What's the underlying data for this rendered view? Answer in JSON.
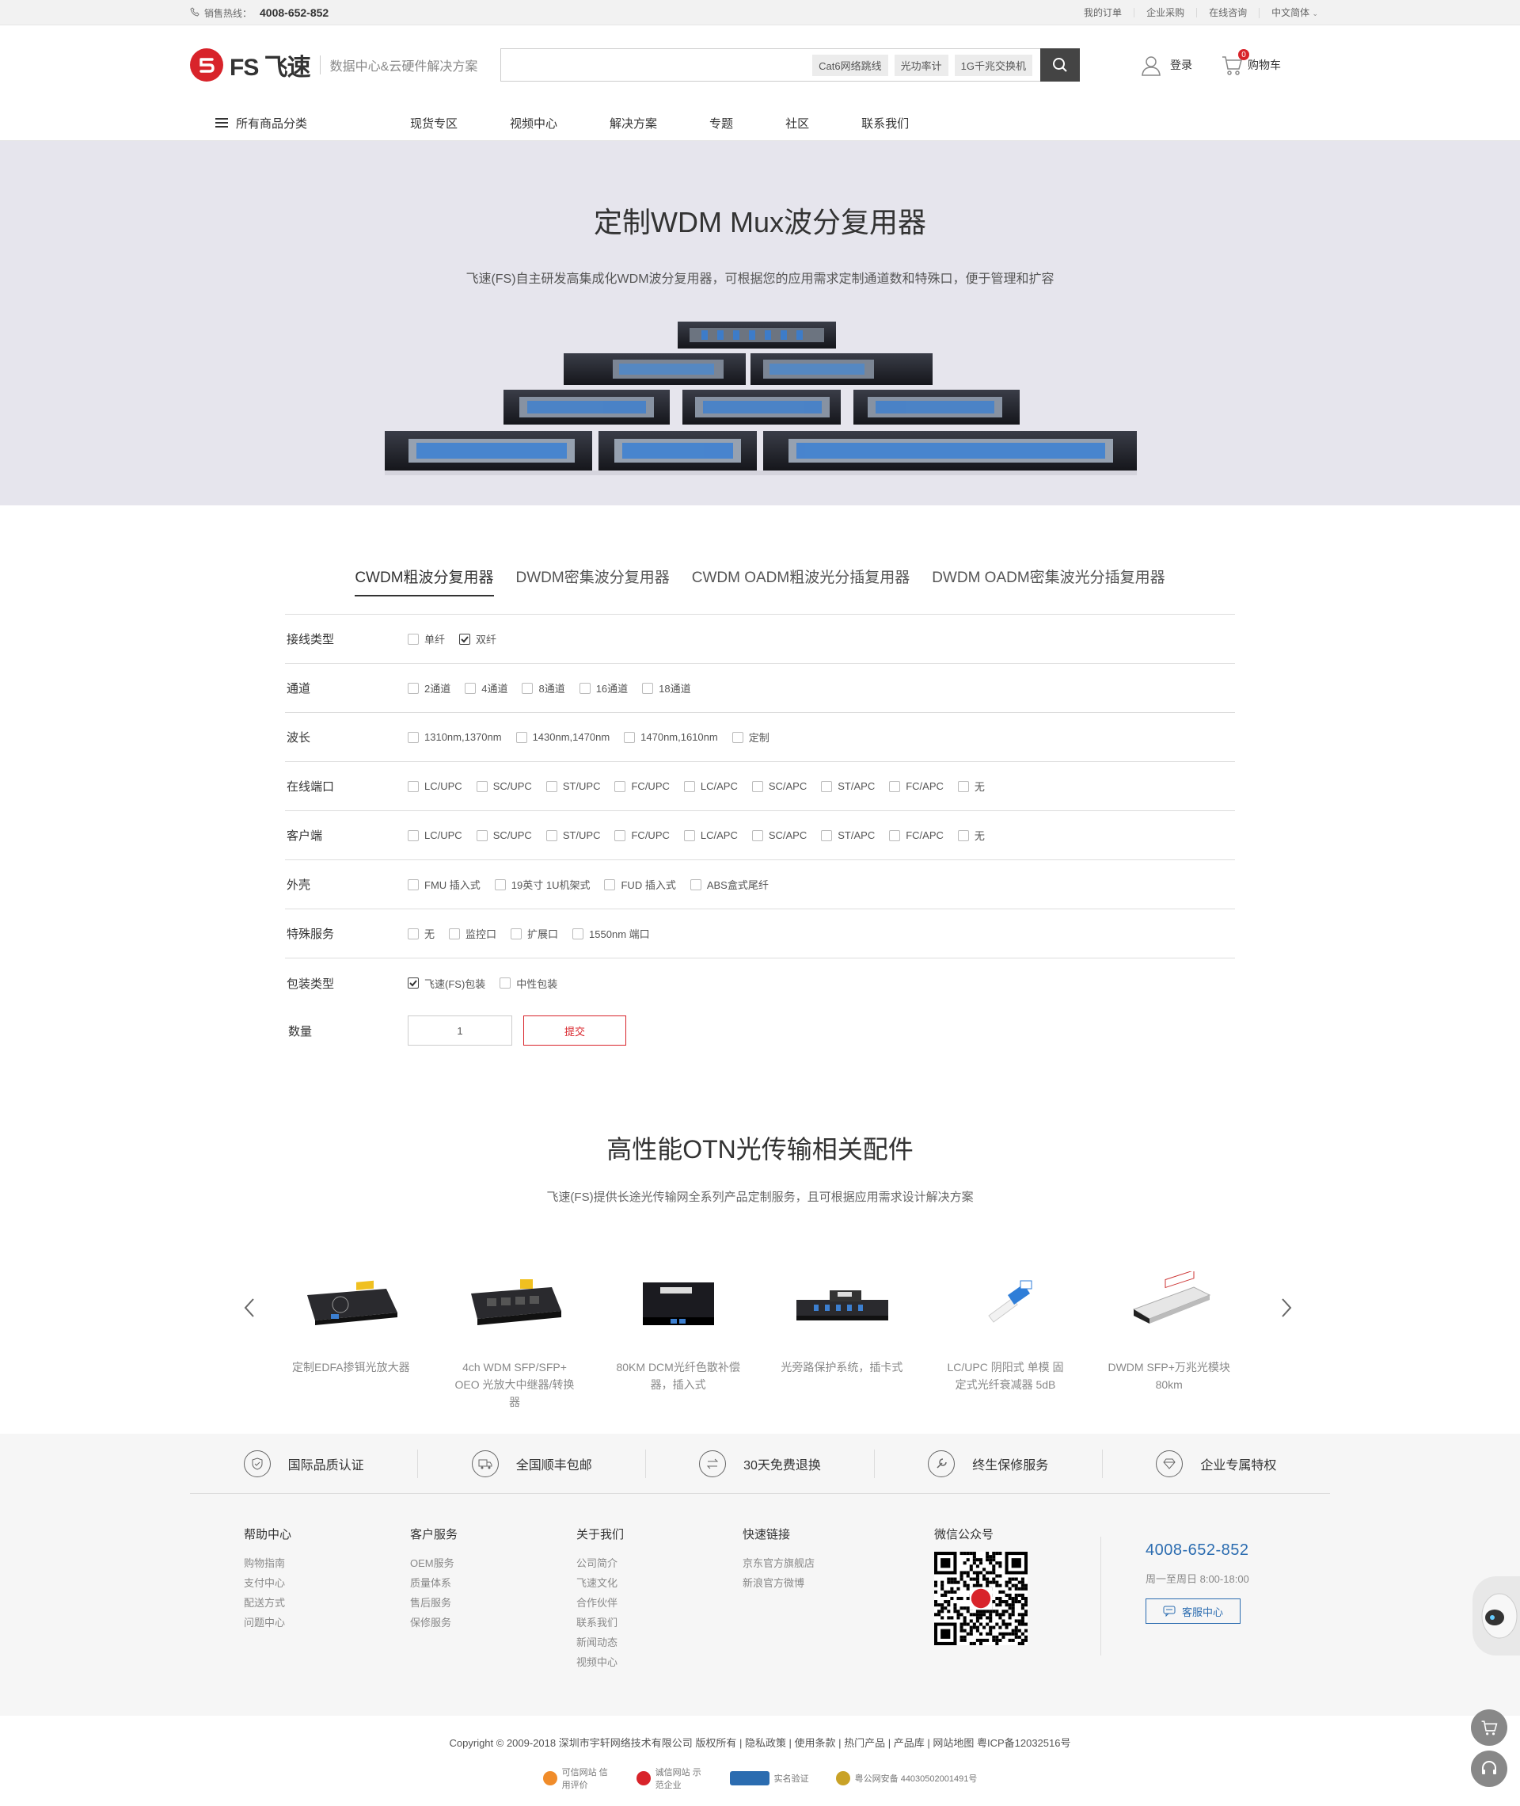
{
  "topbar": {
    "hotline_label": "销售热线：",
    "hotline_number": "4008-652-852",
    "links": [
      "我的订单",
      "企业采购",
      "在线咨询",
      "中文简体"
    ]
  },
  "header": {
    "logo_text": "FS 飞速",
    "slogan": "数据中心&云硬件解决方案",
    "search_tags": [
      "Cat6网络跳线",
      "光功率计",
      "1G千兆交换机"
    ],
    "login": "登录",
    "cart_label": "购物车",
    "cart_count": "0"
  },
  "nav": {
    "all_categories": "所有商品分类",
    "items": [
      "现货专区",
      "视频中心",
      "解决方案",
      "专题",
      "社区",
      "联系我们"
    ]
  },
  "banner": {
    "title": "定制WDM Mux波分复用器",
    "subtitle": "飞速(FS)自主研发高集成化WDM波分复用器，可根据您的应用需求定制通道数和特殊口，便于管理和扩容"
  },
  "tabs": [
    "CWDM粗波分复用器",
    "DWDM密集波分复用器",
    "CWDM OADM粗波光分插复用器",
    "DWDM OADM密集波光分插复用器"
  ],
  "form": {
    "rows": [
      {
        "label": "接线类型",
        "options": [
          {
            "text": "单纤",
            "checked": false
          },
          {
            "text": "双纤",
            "checked": true
          }
        ]
      },
      {
        "label": "通道",
        "options": [
          {
            "text": "2通道",
            "checked": false
          },
          {
            "text": "4通道",
            "checked": false
          },
          {
            "text": "8通道",
            "checked": false
          },
          {
            "text": "16通道",
            "checked": false
          },
          {
            "text": "18通道",
            "checked": false
          }
        ]
      },
      {
        "label": "波长",
        "options": [
          {
            "text": "1310nm,1370nm",
            "checked": false
          },
          {
            "text": "1430nm,1470nm",
            "checked": false
          },
          {
            "text": "1470nm,1610nm",
            "checked": false
          },
          {
            "text": "定制",
            "checked": false
          }
        ]
      },
      {
        "label": "在线端口",
        "options": [
          {
            "text": "LC/UPC",
            "checked": false
          },
          {
            "text": "SC/UPC",
            "checked": false
          },
          {
            "text": "ST/UPC",
            "checked": false
          },
          {
            "text": "FC/UPC",
            "checked": false
          },
          {
            "text": "LC/APC",
            "checked": false
          },
          {
            "text": "SC/APC",
            "checked": false
          },
          {
            "text": "ST/APC",
            "checked": false
          },
          {
            "text": "FC/APC",
            "checked": false
          },
          {
            "text": "无",
            "checked": false
          }
        ]
      },
      {
        "label": "客户端",
        "options": [
          {
            "text": "LC/UPC",
            "checked": false
          },
          {
            "text": "SC/UPC",
            "checked": false
          },
          {
            "text": "ST/UPC",
            "checked": false
          },
          {
            "text": "FC/UPC",
            "checked": false
          },
          {
            "text": "LC/APC",
            "checked": false
          },
          {
            "text": "SC/APC",
            "checked": false
          },
          {
            "text": "ST/APC",
            "checked": false
          },
          {
            "text": "FC/APC",
            "checked": false
          },
          {
            "text": "无",
            "checked": false
          }
        ]
      },
      {
        "label": "外壳",
        "options": [
          {
            "text": "FMU 插入式",
            "checked": false
          },
          {
            "text": "19英寸 1U机架式",
            "checked": false
          },
          {
            "text": "FUD 插入式",
            "checked": false
          },
          {
            "text": "ABS盒式尾纤",
            "checked": false
          }
        ]
      },
      {
        "label": "特殊服务",
        "options": [
          {
            "text": "无",
            "checked": false
          },
          {
            "text": "监控口",
            "checked": false
          },
          {
            "text": "扩展口",
            "checked": false
          },
          {
            "text": "1550nm 端口",
            "checked": false
          }
        ]
      },
      {
        "label": "包装类型",
        "options": [
          {
            "text": "飞速(FS)包装",
            "checked": true
          },
          {
            "text": "中性包装",
            "checked": false
          }
        ]
      }
    ],
    "qty_label": "数量",
    "qty_value": "1",
    "submit": "提交"
  },
  "accessories": {
    "title": "高性能OTN光传输相关配件",
    "subtitle": "飞速(FS)提供长途光传输网全系列产品定制服务，且可根据应用需求设计解决方案",
    "products": [
      {
        "name": "定制EDFA掺铒光放大器",
        "icon": "edfa-amplifier"
      },
      {
        "name": "4ch WDM SFP/SFP+ OEO 光放大中继器/转换器",
        "icon": "oeo-converter"
      },
      {
        "name": "80KM DCM光纤色散补偿器，插入式",
        "icon": "dcm-module"
      },
      {
        "name": "光旁路保护系统，插卡式",
        "icon": "bypass-card"
      },
      {
        "name": "LC/UPC 阴阳式 单模 固定式光纤衰减器 5dB",
        "icon": "attenuator"
      },
      {
        "name": "DWDM SFP+万兆光模块 80km",
        "icon": "sfp-module"
      }
    ]
  },
  "services": [
    "国际品质认证",
    "全国顺丰包邮",
    "30天免费退换",
    "终生保修服务",
    "企业专属特权"
  ],
  "footer": {
    "columns": [
      {
        "title": "帮助中心",
        "links": [
          "购物指南",
          "支付中心",
          "配送方式",
          "问题中心"
        ]
      },
      {
        "title": "客户服务",
        "links": [
          "OEM服务",
          "质量体系",
          "售后服务",
          "保修服务"
        ]
      },
      {
        "title": "关于我们",
        "links": [
          "公司简介",
          "飞速文化",
          "合作伙伴",
          "联系我们",
          "新闻动态",
          "视频中心"
        ]
      },
      {
        "title": "快速链接",
        "links": [
          "京东官方旗舰店",
          "新浪官方微博"
        ]
      }
    ],
    "wechat_title": "微信公众号",
    "tel": "4008-652-852",
    "hours": "周一至周日 8:00-18:00",
    "cs_button": "客服中心",
    "copyright": "Copyright © 2009-2018 深圳市宇轩网络技术有限公司  版权所有 | 隐私政策 | 使用条款 | 热门产品 | 产品库 | 网站地图   粤ICP备12032516号",
    "badges": [
      "可信网站 信用评价",
      "诚信网站 示范企业",
      "实名验证",
      "粤公网安备 44030502001491号"
    ]
  },
  "colors": {
    "brand": "#d8232a",
    "link_blue": "#2b6cb0",
    "banner_bg": "#e6e5ed"
  }
}
